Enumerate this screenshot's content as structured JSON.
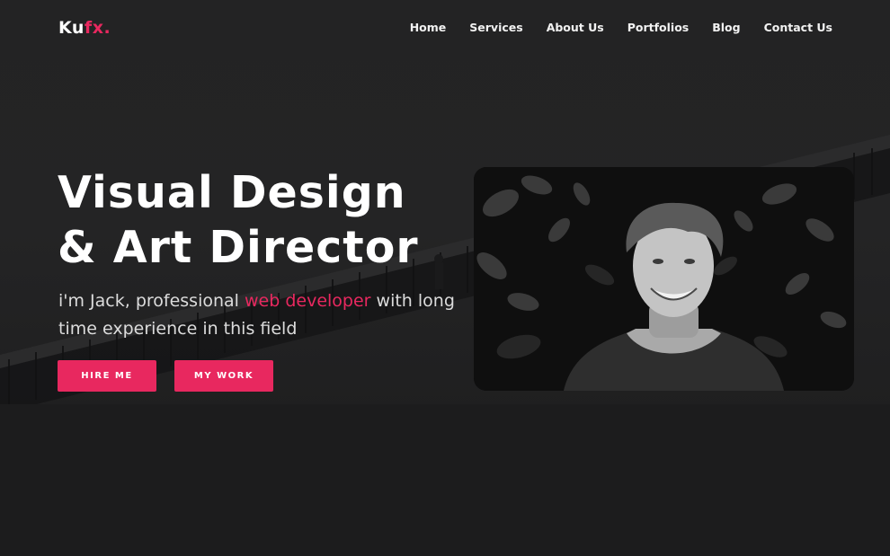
{
  "brand": {
    "logo_main": "Ku",
    "logo_accent": "fx."
  },
  "nav": {
    "items": [
      "Home",
      "Services",
      "About Us",
      "Portfolios",
      "Blog",
      "Contact Us"
    ]
  },
  "hero": {
    "title_line1": "Visual Design",
    "title_line2": "& Art Director",
    "subtitle_pre": "i'm Jack, professional ",
    "subtitle_highlight": "web developer",
    "subtitle_post": " with long time experience in this field",
    "hire_button": "HIRE ME",
    "work_button": "MY WORK"
  },
  "colors": {
    "accent": "#e8285f",
    "background": "#1c1c1d",
    "text": "#ffffff"
  },
  "icons": {
    "portrait": "smiling-man-photo"
  }
}
